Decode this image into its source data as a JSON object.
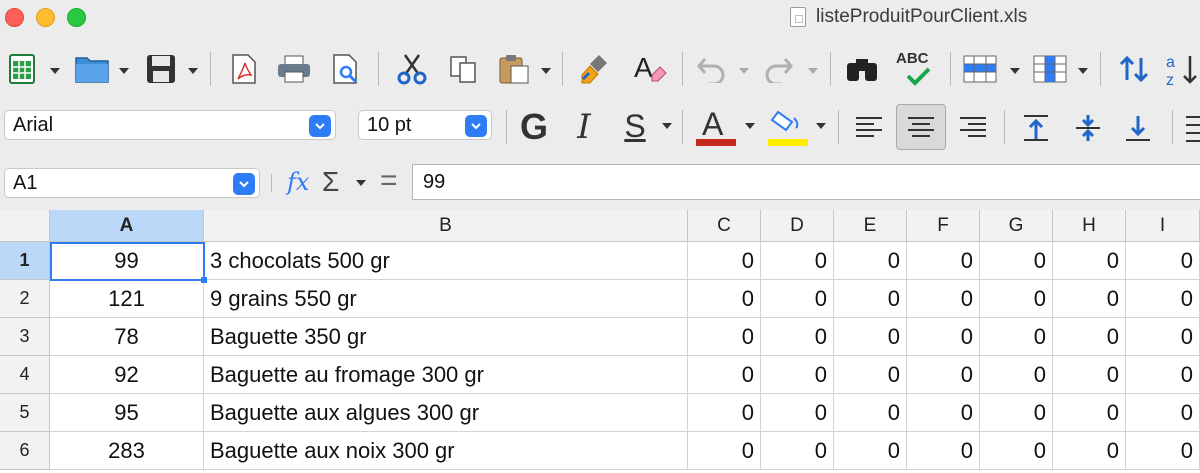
{
  "window": {
    "title": "listeProduitPourClient.xls"
  },
  "toolbar": {
    "icons": [
      "new-spreadsheet-icon",
      "open-folder-icon",
      "save-icon",
      "export-pdf-icon",
      "print-icon",
      "print-preview-icon",
      "cut-icon",
      "copy-icon",
      "paste-icon",
      "clone-formatting-icon",
      "clear-formatting-icon",
      "undo-icon",
      "redo-icon",
      "find-replace-icon",
      "spelling-icon",
      "row-icon",
      "column-icon",
      "sort-icon",
      "sort-ascending-icon"
    ],
    "spelling_label": "ABC"
  },
  "format": {
    "font_name": "Arial",
    "font_size": "10 pt",
    "bold_label": "G",
    "italic_label": "I",
    "underline_label": "S",
    "fontcolor_label": "A",
    "font_color": "#c42b1c",
    "highlight_color": "#ffee00",
    "accent": "#2e7cf6"
  },
  "formula": {
    "cell_ref": "A1",
    "fx_label": "fx",
    "sigma_label": "Σ",
    "equals_label": "=",
    "value": "99"
  },
  "sheet": {
    "columns": [
      "A",
      "B",
      "C",
      "D",
      "E",
      "F",
      "G",
      "H",
      "I"
    ],
    "selected_column": "A",
    "selected_row": "1",
    "rows": [
      {
        "num": "1",
        "a": "99",
        "b": "3 chocolats 500 gr",
        "rest": [
          "0",
          "0",
          "0",
          "0",
          "0",
          "0",
          "0"
        ]
      },
      {
        "num": "2",
        "a": "121",
        "b": "9 grains 550 gr",
        "rest": [
          "0",
          "0",
          "0",
          "0",
          "0",
          "0",
          "0"
        ]
      },
      {
        "num": "3",
        "a": "78",
        "b": "Baguette 350 gr",
        "rest": [
          "0",
          "0",
          "0",
          "0",
          "0",
          "0",
          "0"
        ]
      },
      {
        "num": "4",
        "a": "92",
        "b": "Baguette au fromage 300 gr",
        "rest": [
          "0",
          "0",
          "0",
          "0",
          "0",
          "0",
          "0"
        ]
      },
      {
        "num": "5",
        "a": "95",
        "b": "Baguette aux algues 300 gr",
        "rest": [
          "0",
          "0",
          "0",
          "0",
          "0",
          "0",
          "0"
        ]
      },
      {
        "num": "6",
        "a": "283",
        "b": "Baguette aux noix 300 gr",
        "rest": [
          "0",
          "0",
          "0",
          "0",
          "0",
          "0",
          "0"
        ]
      }
    ]
  }
}
